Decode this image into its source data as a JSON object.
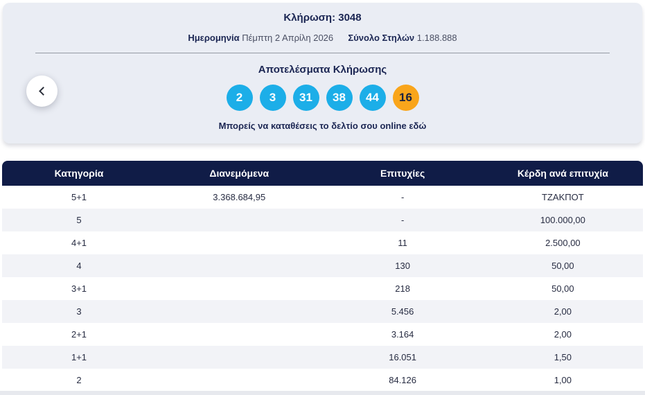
{
  "draw": {
    "title": "Κλήρωση: 3048",
    "date_label": "Ημερομηνία",
    "date_value": "Πέμπτη 2 Απρίλη 2026",
    "columns_label": "Σύνολο Στηλών",
    "columns_value": "1.188.888",
    "results_title": "Αποτελέσματα Κλήρωσης",
    "numbers": [
      "2",
      "3",
      "31",
      "38",
      "44"
    ],
    "joker": "16",
    "deposit_link": "Μπορείς να καταθέσεις το δελτίο σου online εδώ"
  },
  "colors": {
    "ball_blue": "#1caee8",
    "ball_orange": "#f9a51b",
    "header_navy": "#101c47",
    "card_background": "#eaedf4"
  },
  "table": {
    "headers": [
      "Κατηγορία",
      "Διανεμόμενα",
      "Επιτυχίες",
      "Κέρδη ανά επιτυχία"
    ],
    "rows": [
      [
        "5+1",
        "3.368.684,95",
        "-",
        "ΤΖΑΚΠΟΤ"
      ],
      [
        "5",
        "",
        "-",
        "100.000,00"
      ],
      [
        "4+1",
        "",
        "11",
        "2.500,00"
      ],
      [
        "4",
        "",
        "130",
        "50,00"
      ],
      [
        "3+1",
        "",
        "218",
        "50,00"
      ],
      [
        "3",
        "",
        "5.456",
        "2,00"
      ],
      [
        "2+1",
        "",
        "3.164",
        "2,00"
      ],
      [
        "1+1",
        "",
        "16.051",
        "1,50"
      ],
      [
        "2",
        "",
        "84.126",
        "1,00"
      ]
    ]
  }
}
